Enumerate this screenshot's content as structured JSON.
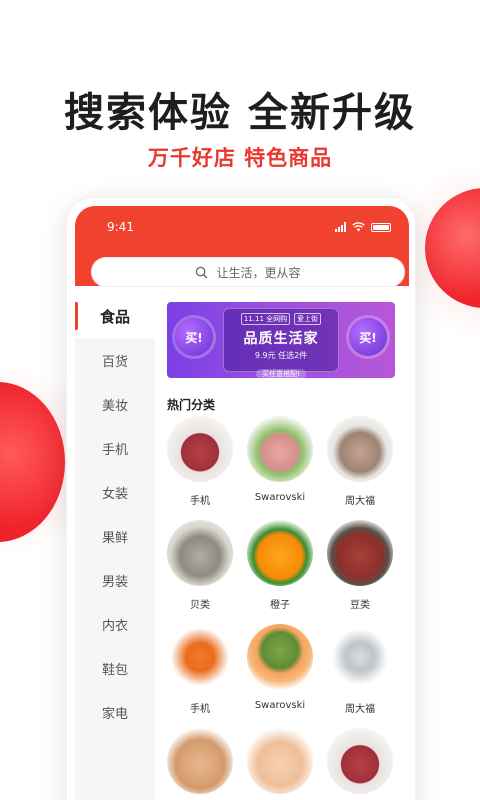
{
  "headline": "搜索体验 全新升级",
  "subline": "万千好店 特色商品",
  "status": {
    "time": "9:41"
  },
  "search": {
    "placeholder": "让生活，更从容"
  },
  "sidebar": {
    "items": [
      {
        "label": "食品",
        "active": true
      },
      {
        "label": "百货"
      },
      {
        "label": "美妆"
      },
      {
        "label": "手机"
      },
      {
        "label": "女装"
      },
      {
        "label": "果鲜"
      },
      {
        "label": "男装"
      },
      {
        "label": "内衣"
      },
      {
        "label": "鞋包"
      },
      {
        "label": "家电"
      }
    ]
  },
  "banner": {
    "left_bubble": "买!",
    "right_bubble": "买!",
    "logo_left": "11.11 全网购",
    "logo_right": "爱上街",
    "title": "品质生活家",
    "promo": "9.9元 任选2件",
    "cta": "买任意搭配!"
  },
  "section_title": "热门分类",
  "categories": [
    {
      "label": "手机",
      "icon": "meat-icon"
    },
    {
      "label": "Swarovski",
      "icon": "pork-icon"
    },
    {
      "label": "周大福",
      "icon": "shrimp-icon"
    },
    {
      "label": "贝类",
      "icon": "oyster-icon"
    },
    {
      "label": "橙子",
      "icon": "orange-icon"
    },
    {
      "label": "豆类",
      "icon": "peanut-icon"
    },
    {
      "label": "手机",
      "icon": "carrot-icon"
    },
    {
      "label": "Swarovski",
      "icon": "melon-icon"
    },
    {
      "label": "周大福",
      "icon": "fish-icon"
    },
    {
      "label": "",
      "icon": "egg-icon"
    },
    {
      "label": "",
      "icon": "chicken-icon"
    },
    {
      "label": "",
      "icon": "meat-icon"
    }
  ],
  "colors": {
    "accent": "#f0422e",
    "headline": "#1e1e1e",
    "subline": "#e8382f"
  }
}
